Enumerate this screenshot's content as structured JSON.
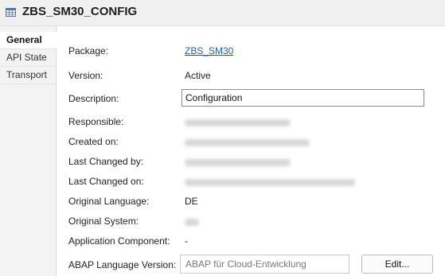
{
  "window": {
    "title": "ZBS_SM30_CONFIG"
  },
  "tabs": [
    {
      "label": "General"
    },
    {
      "label": "API State"
    },
    {
      "label": "Transport"
    }
  ],
  "fields": {
    "package": {
      "label": "Package:",
      "value": "ZBS_SM30"
    },
    "version": {
      "label": "Version:",
      "value": "Active"
    },
    "description": {
      "label": "Description:",
      "value": "Configuration"
    },
    "responsible": {
      "label": "Responsible:"
    },
    "created_on": {
      "label": "Created on:"
    },
    "last_changed_by": {
      "label": "Last Changed by:"
    },
    "last_changed_on": {
      "label": "Last Changed on:"
    },
    "original_language": {
      "label": "Original Language:",
      "value": "DE"
    },
    "original_system": {
      "label": "Original System:"
    },
    "application_component": {
      "label": "Application Component:",
      "value": "-"
    },
    "abap_language_version": {
      "label": "ABAP Language Version:",
      "value": "ABAP für Cloud-Entwicklung",
      "button": "Edit..."
    }
  },
  "colors": {
    "link": "#1a5fb4",
    "active_tab_bg": "#ffffff",
    "sidebar_bg": "#f3f3f3"
  }
}
